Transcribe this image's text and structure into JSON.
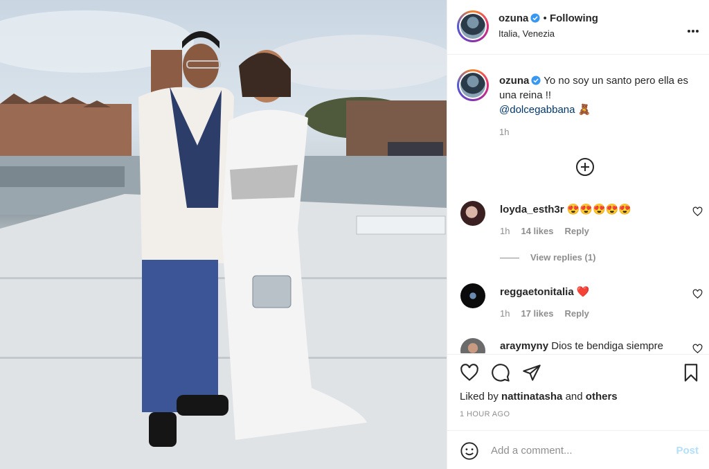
{
  "post": {
    "username": "ozuna",
    "separator": "•",
    "following_label": "Following",
    "location": "Italia, Venezia",
    "more_icon": "more-horizontal-icon"
  },
  "caption": {
    "username": "ozuna",
    "text": "Yo no soy un santo pero ella es una reina !!",
    "mention": "@dolcegabbana",
    "emoji": "🧸",
    "time": "1h"
  },
  "comments": [
    {
      "username": "loyda_esth3r",
      "text": "😍😍😍😍😍",
      "time": "1h",
      "likes": "14 likes",
      "reply": "Reply"
    },
    {
      "username": "reggaetonitalia",
      "text": "❤️",
      "time": "1h",
      "likes": "17 likes",
      "reply": "Reply"
    },
    {
      "username": "araymyny",
      "text": "Dios te bendiga siempre"
    }
  ],
  "view_replies": "View replies (1)",
  "liked_by": {
    "prefix": "Liked by",
    "user": "nattinatasha",
    "and": "and",
    "others": "others"
  },
  "timestamp": "1 HOUR AGO",
  "add_comment": {
    "placeholder": "Add a comment...",
    "post_label": "Post"
  },
  "colors": {
    "accent": "#0095f6",
    "post_disabled": "#b2dffc",
    "verified": "#3897f0",
    "like_red": "#ed4956"
  }
}
